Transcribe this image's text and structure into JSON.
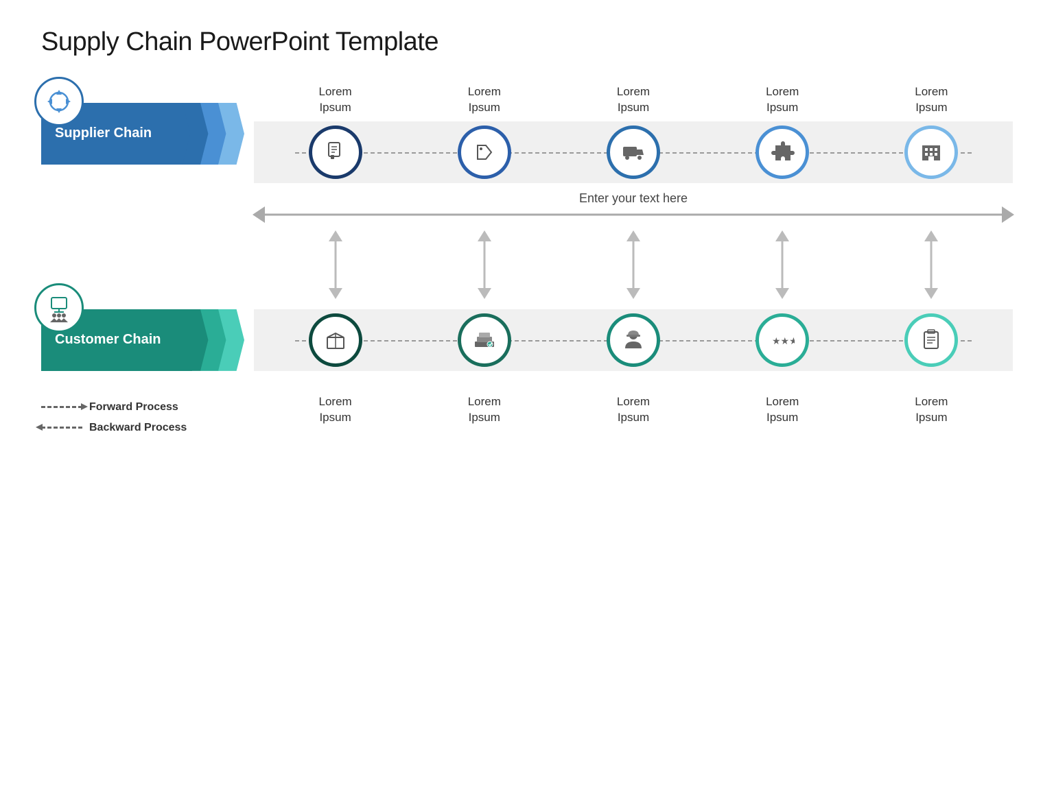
{
  "title": "Supply Chain PowerPoint Template",
  "supplier": {
    "label": "Supplier Chain",
    "circles": [
      {
        "id": 1,
        "icon": "document"
      },
      {
        "id": 2,
        "icon": "tag"
      },
      {
        "id": 3,
        "icon": "truck"
      },
      {
        "id": 4,
        "icon": "puzzle"
      },
      {
        "id": 5,
        "icon": "building"
      }
    ],
    "labels": [
      {
        "line1": "Lorem",
        "line2": "Ipsum"
      },
      {
        "line1": "Lorem",
        "line2": "Ipsum"
      },
      {
        "line1": "Lorem",
        "line2": "Ipsum"
      },
      {
        "line1": "Lorem",
        "line2": "Ipsum"
      },
      {
        "line1": "Lorem",
        "line2": "Ipsum"
      }
    ]
  },
  "customer": {
    "label": "Customer Chain",
    "circles": [
      {
        "id": 1,
        "icon": "box"
      },
      {
        "id": 2,
        "icon": "stack"
      },
      {
        "id": 3,
        "icon": "person"
      },
      {
        "id": 4,
        "icon": "stars"
      },
      {
        "id": 5,
        "icon": "clipboard"
      }
    ],
    "labels": [
      {
        "line1": "Lorem",
        "line2": "Ipsum"
      },
      {
        "line1": "Lorem",
        "line2": "Ipsum"
      },
      {
        "line1": "Lorem",
        "line2": "Ipsum"
      },
      {
        "line1": "Lorem",
        "line2": "Ipsum"
      },
      {
        "line1": "Lorem",
        "line2": "Ipsum"
      }
    ]
  },
  "middle_text": "Enter your text here",
  "legend": {
    "forward": "Forward Process",
    "backward": "Backward Process"
  }
}
